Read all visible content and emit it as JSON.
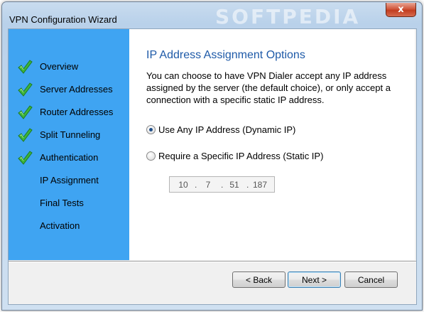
{
  "window": {
    "title": "VPN Configuration Wizard",
    "watermark": "SOFTPEDIA",
    "close_glyph": "x"
  },
  "sidebar": {
    "background": "#3fa4f2",
    "items": [
      {
        "label": "Overview",
        "completed": true
      },
      {
        "label": "Server Addresses",
        "completed": true
      },
      {
        "label": "Router Addresses",
        "completed": true
      },
      {
        "label": "Split Tunneling",
        "completed": true
      },
      {
        "label": "Authentication",
        "completed": true
      },
      {
        "label": "IP Assignment",
        "completed": false
      },
      {
        "label": "Final Tests",
        "completed": false
      },
      {
        "label": "Activation",
        "completed": false
      }
    ]
  },
  "main": {
    "heading": "IP Address Assignment Options",
    "heading_color": "#1e5aa8",
    "description": "You can choose to have VPN Dialer accept any IP address assigned by the server (the default choice), or only accept a connection with a specific static IP address.",
    "options": [
      {
        "label": "Use Any IP Address (Dynamic IP)",
        "selected": true
      },
      {
        "label": "Require a Specific IP Address (Static IP)",
        "selected": false
      }
    ],
    "ip_address": {
      "octets": [
        "10",
        "7",
        "51",
        "187"
      ],
      "separator": ".",
      "enabled": false
    }
  },
  "buttons": {
    "back": "< Back",
    "next": "Next >",
    "cancel": "Cancel"
  },
  "icons": {
    "check": "green-check-icon",
    "close": "close-icon"
  }
}
